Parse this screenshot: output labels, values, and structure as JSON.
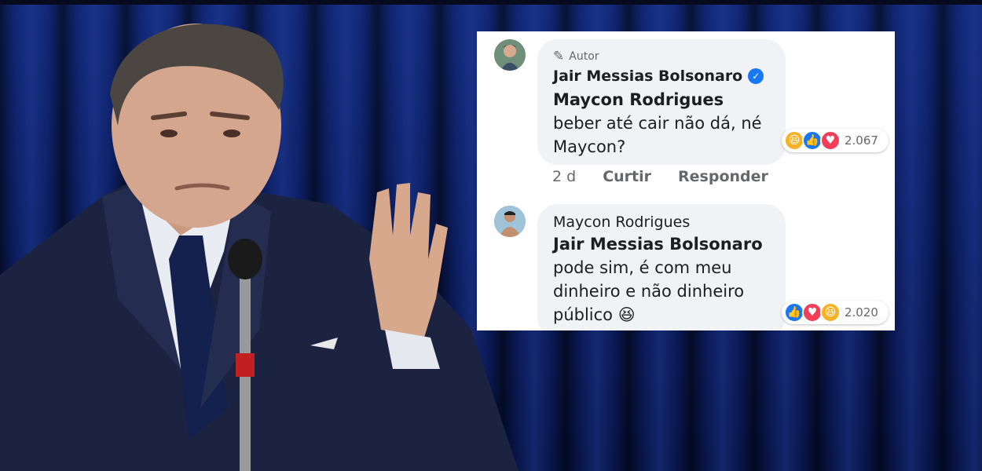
{
  "comments": [
    {
      "author_tag": "Autor",
      "author": "Jair Messias Bolsonaro",
      "mention": "Maycon Rodrigues",
      "text": " beber até cair não dá, né Maycon?",
      "reaction_count": "2.067",
      "reactions": [
        "haha-icon",
        "like-icon",
        "love-icon"
      ],
      "actions": {
        "time": "2 d",
        "like": "Curtir",
        "reply": "Responder"
      }
    },
    {
      "author": "Maycon Rodrigues",
      "mention": "Jair Messias Bolsonaro",
      "text": "pode sim, é com meu dinheiro e não dinheiro público",
      "emoji": "😆",
      "reaction_count": "2.020",
      "reactions": [
        "like-icon",
        "love-icon",
        "haha-icon"
      ]
    }
  ],
  "colors": {
    "facebook_blue": "#1877f2",
    "bubble_gray": "#f0f2f5",
    "background_curtain": "#132a7a"
  }
}
